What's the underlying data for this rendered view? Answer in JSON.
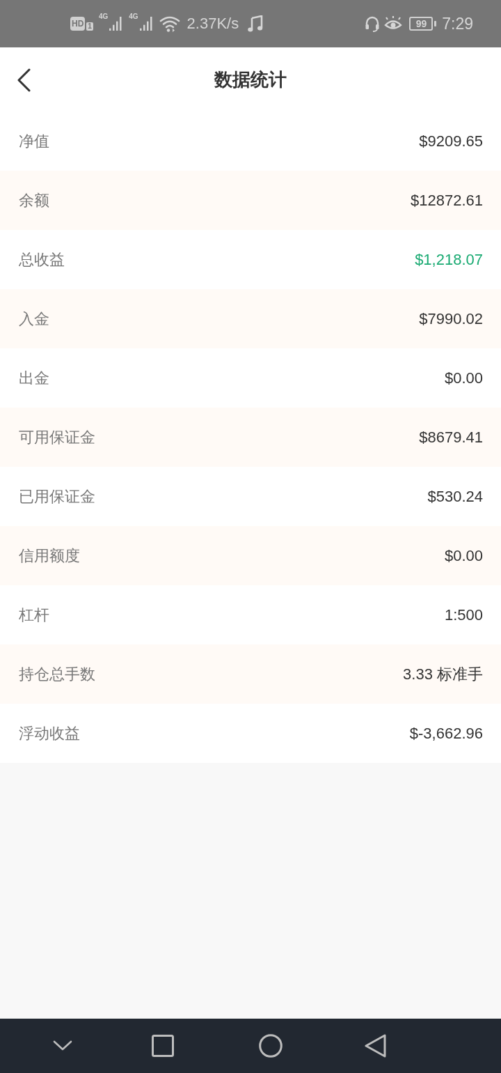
{
  "status_bar": {
    "hd_badge": "HD",
    "sim_slot": "1",
    "network_types": [
      "4G",
      "4G"
    ],
    "speed": "2.37K/s",
    "battery": "99",
    "time": "7:29"
  },
  "header": {
    "title": "数据统计"
  },
  "rows": [
    {
      "label": "净值",
      "value": "$9209.65",
      "color": "#333333"
    },
    {
      "label": "余额",
      "value": "$12872.61",
      "color": "#333333"
    },
    {
      "label": "总收益",
      "value": "$1,218.07",
      "color": "#19aa72"
    },
    {
      "label": "入金",
      "value": "$7990.02",
      "color": "#333333"
    },
    {
      "label": "出金",
      "value": "$0.00",
      "color": "#333333"
    },
    {
      "label": "可用保证金",
      "value": "$8679.41",
      "color": "#333333"
    },
    {
      "label": "已用保证金",
      "value": "$530.24",
      "color": "#333333"
    },
    {
      "label": "信用额度",
      "value": "$0.00",
      "color": "#333333"
    },
    {
      "label": "杠杆",
      "value": "1:500",
      "color": "#333333"
    },
    {
      "label": "持仓总手数",
      "value": "3.33 标准手",
      "color": "#333333"
    },
    {
      "label": "浮动收益",
      "value": "$-3,662.96",
      "color": "#333333"
    }
  ]
}
